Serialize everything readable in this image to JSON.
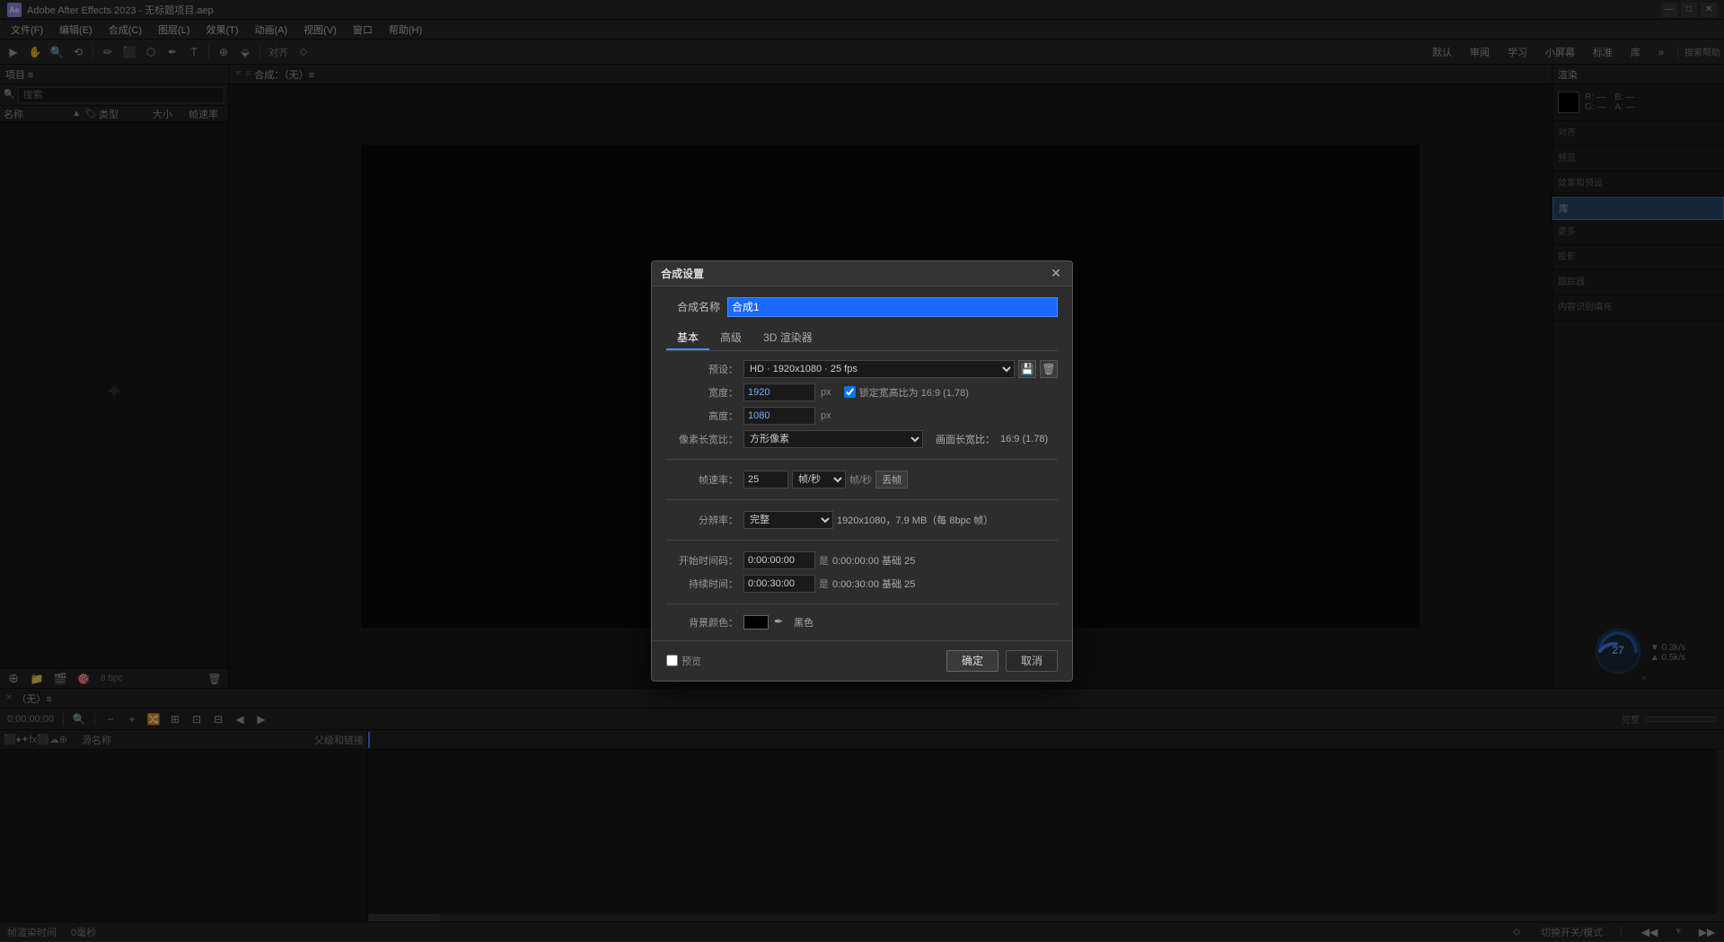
{
  "app": {
    "title": "Adobe After Effects 2023 - 无标题项目.aep",
    "icon_label": "Ae"
  },
  "title_bar": {
    "title": "Adobe After Effects 2023 - 无标题项目.aep",
    "minimize_label": "—",
    "maximize_label": "□",
    "close_label": "✕"
  },
  "menu": {
    "items": [
      {
        "label": "文件(F)"
      },
      {
        "label": "编辑(E)"
      },
      {
        "label": "合成(C)"
      },
      {
        "label": "图层(L)"
      },
      {
        "label": "效果(T)"
      },
      {
        "label": "动画(A)"
      },
      {
        "label": "视图(V)"
      },
      {
        "label": "窗口"
      },
      {
        "label": "帮助(H)"
      }
    ]
  },
  "toolbar": {
    "tools": [
      "▶",
      "↩",
      "✋",
      "🔍",
      "⟲",
      "✏",
      "⬛",
      "⬡",
      "✒",
      "T",
      "⊕",
      "⬙",
      "❖",
      "⬦"
    ],
    "workspaces": [
      "默认",
      "审阅",
      "学习",
      "小屏幕",
      "标准",
      "库"
    ]
  },
  "left_panel": {
    "title": "项目 ≡",
    "search_placeholder": "搜索",
    "columns": {
      "name": "名称",
      "type": "类型",
      "size": "大小",
      "fps": "帧速率"
    },
    "empty_message": ""
  },
  "comp_panel": {
    "header": "合成：（无）≡",
    "empty_message": ""
  },
  "right_panel": {
    "title": "渲染",
    "sections": {
      "align": "对齐",
      "preview": "预览",
      "effects_presets": "效果和预设",
      "active": "库",
      "more": "更多",
      "mask": "投影",
      "tracker": "跟踪器",
      "content_tool": "内容识别填充"
    },
    "meter": {
      "value": "27",
      "unit": "×",
      "download": "0.3k/s",
      "upload": "0.5k/s"
    }
  },
  "timeline": {
    "header": "（无）≡",
    "time_display": "0;00;00;00",
    "zoom_label": "完整",
    "columns": {
      "source_name": "源名称",
      "properties": "半♦∧fx⬛☁⊕",
      "parent": "父级和链接"
    },
    "bpc_label": "8 bpc"
  },
  "status_bar": {
    "render_label": "帧渲染时间",
    "time_value": "0毫秒",
    "toggle_label": "切换开关/模式"
  },
  "modal": {
    "title": "合成设置",
    "close_label": "✕",
    "comp_name_label": "合成名称",
    "comp_name_value": "合成1",
    "tabs": [
      {
        "label": "基本",
        "active": true
      },
      {
        "label": "高级"
      },
      {
        "label": "3D 渲染器"
      }
    ],
    "preset_label": "预设：",
    "preset_value": "HD · 1920x1080 · 25 fps",
    "preset_save_icon": "💾",
    "preset_delete_icon": "🗑",
    "width_label": "宽度：",
    "width_value": "1920",
    "width_unit": "px",
    "lock_check_label": "锁定宽高比为 16:9 (1.78)",
    "height_label": "高度：",
    "height_value": "1080",
    "height_unit": "px",
    "pixel_ar_label": "像素长宽比：",
    "pixel_ar_value": "方形像素",
    "frame_ar_label": "画面长宽比：",
    "frame_ar_value": "16:9 (1.78)",
    "fps_label": "帧速率：",
    "fps_value": "25",
    "fps_unit": "帧/秒",
    "dropframe_label": "丢帧",
    "resolution_label": "分辨率：",
    "resolution_value": "完整",
    "resolution_info": "1920x1080，7.9 MB（每 8bpc 帧）",
    "start_time_label": "开始时间码：",
    "start_time_value": "0:00:00:00",
    "start_time_equals": "是 0:00:00:00",
    "start_time_base": "基础 25",
    "duration_label": "持续时间：",
    "duration_value": "0:00:30:00",
    "duration_equals": "是 0:00:30:00",
    "duration_base": "基础 25",
    "bg_label": "背景颜色：",
    "bg_color": "#000000",
    "bg_color_name": "黑色",
    "preview_label": "预览",
    "ok_label": "确定",
    "cancel_label": "取消"
  }
}
